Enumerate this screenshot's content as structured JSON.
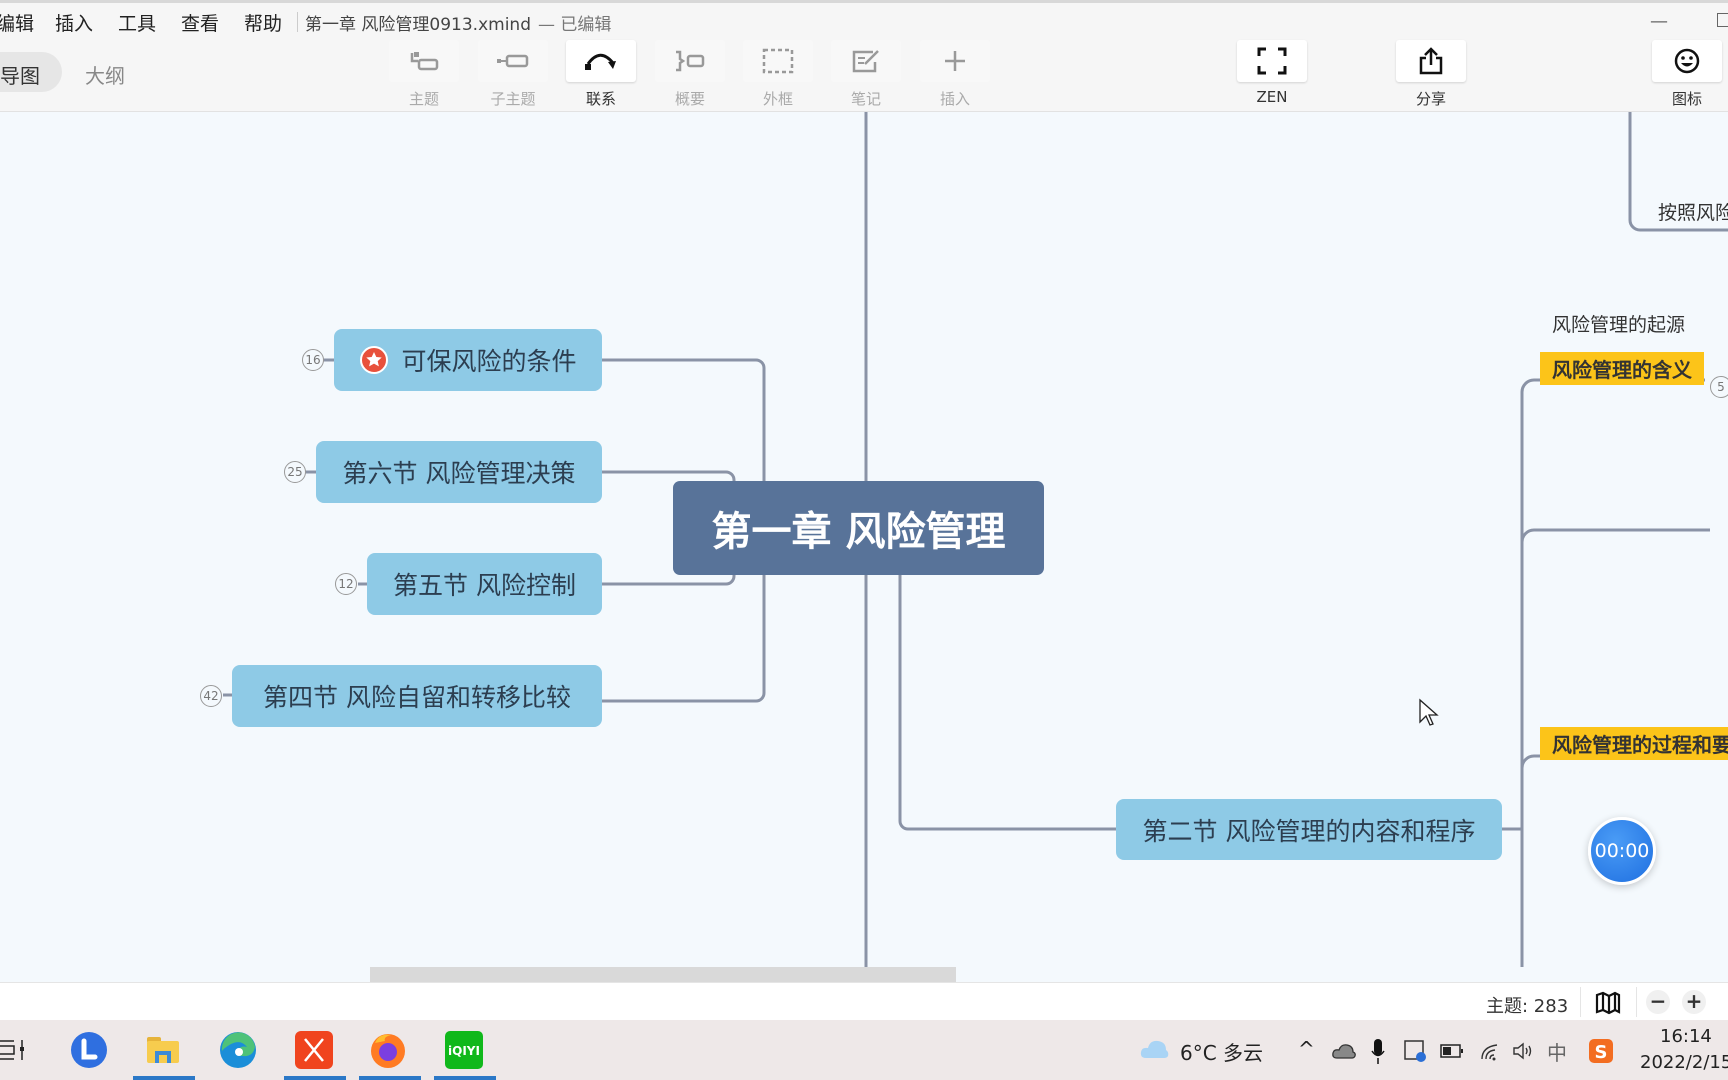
{
  "menubar": {
    "items": [
      "编辑",
      "插入",
      "工具",
      "查看",
      "帮助"
    ],
    "doc_title": "第一章 风险管理0913.xmind",
    "doc_status": "— 已编辑",
    "minimize": "—"
  },
  "view_tabs": {
    "mindmap": "导图",
    "outline": "大纲"
  },
  "toolbar": {
    "tools": [
      {
        "id": "topic",
        "label": "主题",
        "state": "disabled"
      },
      {
        "id": "subtopic",
        "label": "子主题",
        "state": "disabled"
      },
      {
        "id": "relationship",
        "label": "联系",
        "state": "active"
      },
      {
        "id": "summary",
        "label": "概要",
        "state": "disabled"
      },
      {
        "id": "boundary",
        "label": "外框",
        "state": "disabled"
      },
      {
        "id": "note",
        "label": "笔记",
        "state": "disabled"
      },
      {
        "id": "insert",
        "label": "插入",
        "state": "disabled"
      }
    ],
    "zen_label": "ZEN",
    "share_label": "分享",
    "icon_label": "图标"
  },
  "mindmap": {
    "root": "第一章 风险管理",
    "left_nodes": [
      {
        "label": "可保风险的条件",
        "count": "16",
        "marker": "star-red"
      },
      {
        "label": "第六节 风险管理决策",
        "count": "25"
      },
      {
        "label": "第五节 风险控制",
        "count": "12"
      },
      {
        "label": "第四节  风险自留和转移比较",
        "count": "42"
      }
    ],
    "right_node": "第二节 风险管理的内容和程序",
    "right_subtopics": {
      "partial_top": "按照风险",
      "origin": "风险管理的起源",
      "meaning": "风险管理的含义",
      "meaning_count": "5",
      "process": "风险管理的过程和要"
    },
    "colors": {
      "root": "#587399",
      "node": "#8ecae6",
      "highlight": "#fcc419",
      "line": "#8a93a6"
    }
  },
  "timer": "00:00",
  "statusbar": {
    "topic_count": "主题: 283",
    "zoom_out": "−",
    "zoom_in": "+"
  },
  "taskbar": {
    "apps": [
      "Lark",
      "File Explorer",
      "Edge",
      "XMind",
      "Firefox",
      "iQIYI"
    ],
    "weather": "6°C  多云",
    "ime": "中",
    "time": "16:14",
    "date": "2022/2/15"
  }
}
